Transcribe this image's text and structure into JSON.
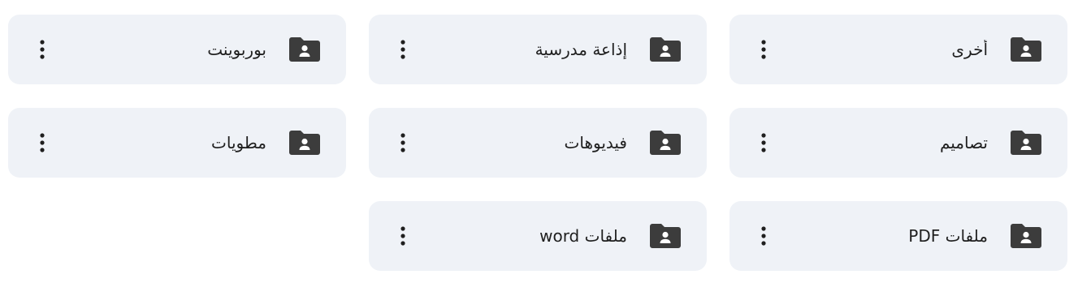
{
  "folders": [
    {
      "name": "أخرى",
      "icon": "shared-folder-icon"
    },
    {
      "name": "إذاعة مدرسية",
      "icon": "shared-folder-icon"
    },
    {
      "name": "بوربوينت",
      "icon": "shared-folder-icon"
    },
    {
      "name": "تصاميم",
      "icon": "shared-folder-icon"
    },
    {
      "name": "فيديوهات",
      "icon": "shared-folder-icon"
    },
    {
      "name": "مطويات",
      "icon": "shared-folder-icon"
    },
    {
      "name": "ملفات PDF",
      "icon": "shared-folder-icon"
    },
    {
      "name": "ملفات word",
      "icon": "shared-folder-icon"
    }
  ],
  "more_actions_icon": "more-vert-icon",
  "colors": {
    "card_background": "#eff2f7",
    "icon": "#3c3c3c",
    "text": "#1f1f1f"
  }
}
